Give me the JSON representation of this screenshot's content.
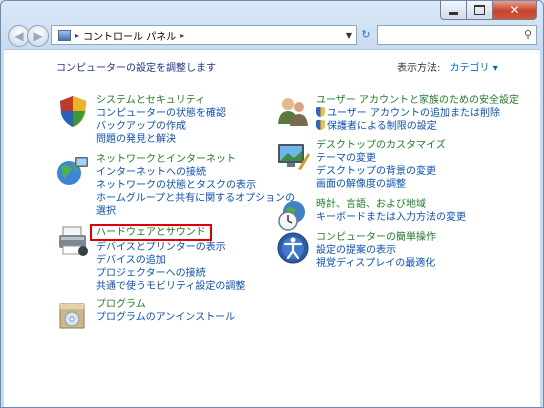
{
  "window": {
    "title": "",
    "caption": {
      "minimize": "",
      "maximize": "",
      "close": "✕"
    }
  },
  "nav": {
    "back": "◀",
    "forward": "▶",
    "breadcrumb": "コントロール パネル",
    "refresh": "↻",
    "search_placeholder": ""
  },
  "main": {
    "heading": "コンピューターの設定を調整します",
    "view_by_label": "表示方法:",
    "view_by_value": "カテゴリ ▾"
  },
  "categories": [
    {
      "title": "システムとセキュリティ",
      "links": [
        "コンピューターの状態を確認",
        "バックアップの作成",
        "問題の発見と解決"
      ],
      "icon": "system-security-icon"
    },
    {
      "title": "ネットワークとインターネット",
      "links": [
        "インターネットへの接続",
        "ネットワークの状態とタスクの表示",
        "ホームグループと共有に関するオプションの",
        "選択"
      ],
      "icon": "network-internet-icon"
    },
    {
      "title": "ハードウェアとサウンド",
      "links": [
        "デバイスとプリンターの表示",
        "デバイスの追加",
        "プロジェクターへの接続",
        "共通で使うモビリティ設定の調整"
      ],
      "icon": "hardware-sound-icon"
    },
    {
      "title": "プログラム",
      "links": [
        "プログラムのアンインストール"
      ],
      "icon": "programs-icon"
    },
    {
      "title": "ユーザー アカウントと家族のための安全設定",
      "links": [
        "ユーザー アカウントの追加または削除",
        "保護者による制限の設定"
      ],
      "icon": "user-accounts-icon"
    },
    {
      "title": "デスクトップのカスタマイズ",
      "links": [
        "テーマの変更",
        "デスクトップの背景の変更",
        "画面の解像度の調整"
      ],
      "icon": "appearance-icon"
    },
    {
      "title": "時計、言語、および地域",
      "links": [
        "キーボードまたは入力方法の変更"
      ],
      "icon": "clock-region-icon"
    },
    {
      "title": "コンピューターの簡単操作",
      "links": [
        "設定の提案の表示",
        "視覚ディスプレイの最適化"
      ],
      "icon": "ease-of-access-icon"
    }
  ],
  "colors": {
    "title_green": "#1f7a29",
    "link_blue": "#0a4fb8",
    "highlight_red": "#e00000"
  }
}
